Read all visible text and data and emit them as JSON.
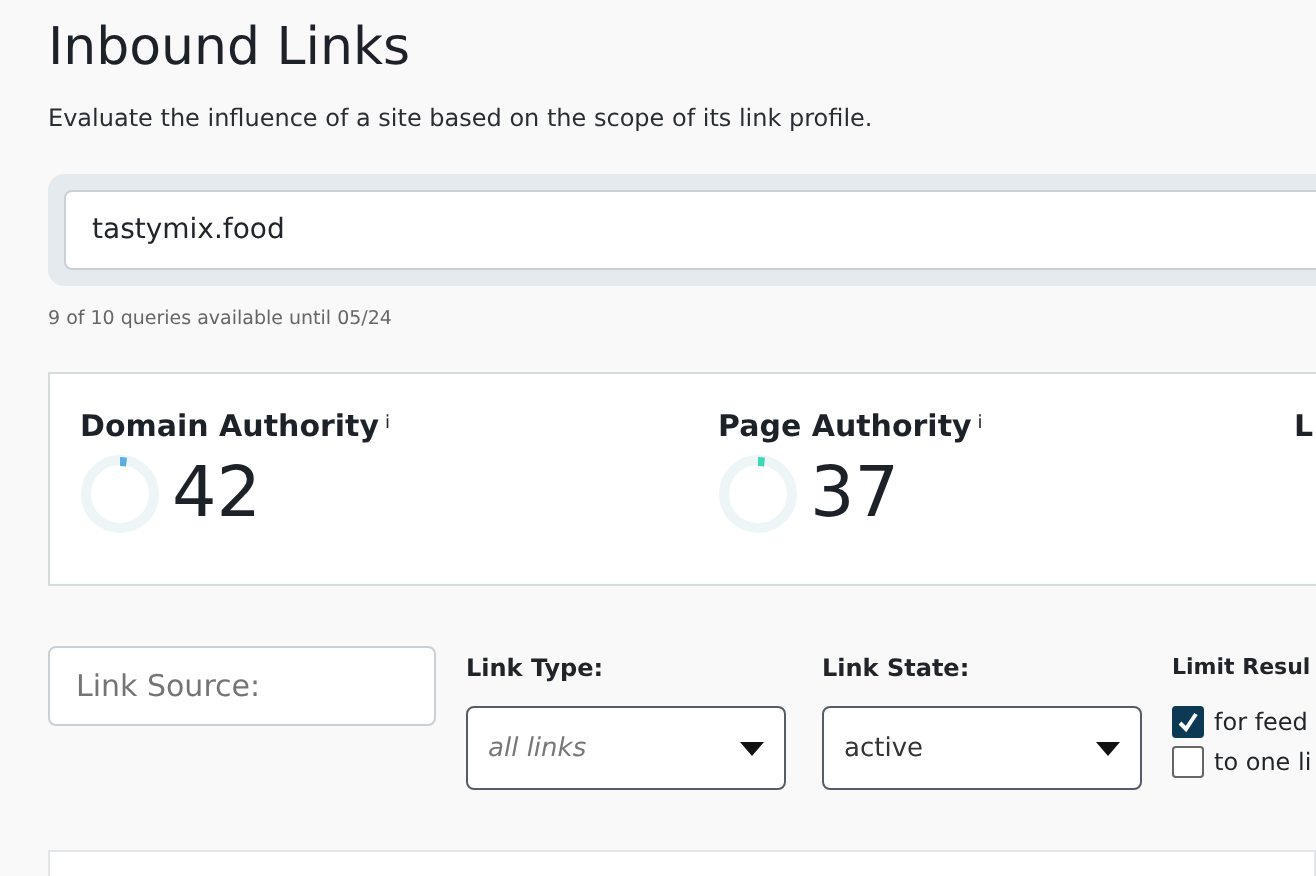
{
  "header": {
    "title": "Inbound Links",
    "subtitle": "Evaluate the influence of a site based on the scope of its link profile."
  },
  "search": {
    "value": "tastymix.food"
  },
  "quota": "9 of 10 queries available until 05/24",
  "metrics": [
    {
      "label": "Domain Authority",
      "info": "i",
      "value": "42",
      "color": "#5aaee0"
    },
    {
      "label": "Page Authority",
      "info": "i",
      "value": "37",
      "color": "#3fd6b8"
    },
    {
      "label": "L"
    }
  ],
  "filters": {
    "link_source": {
      "placeholder": "Link Source:"
    },
    "link_type": {
      "label": "Link Type:",
      "placeholder": "all links"
    },
    "link_state": {
      "label": "Link State:",
      "value": "active"
    },
    "limit": {
      "label": "Limit Resul",
      "options": [
        {
          "label": "for feed",
          "checked": true
        },
        {
          "label": "to one li",
          "checked": false
        }
      ]
    }
  }
}
